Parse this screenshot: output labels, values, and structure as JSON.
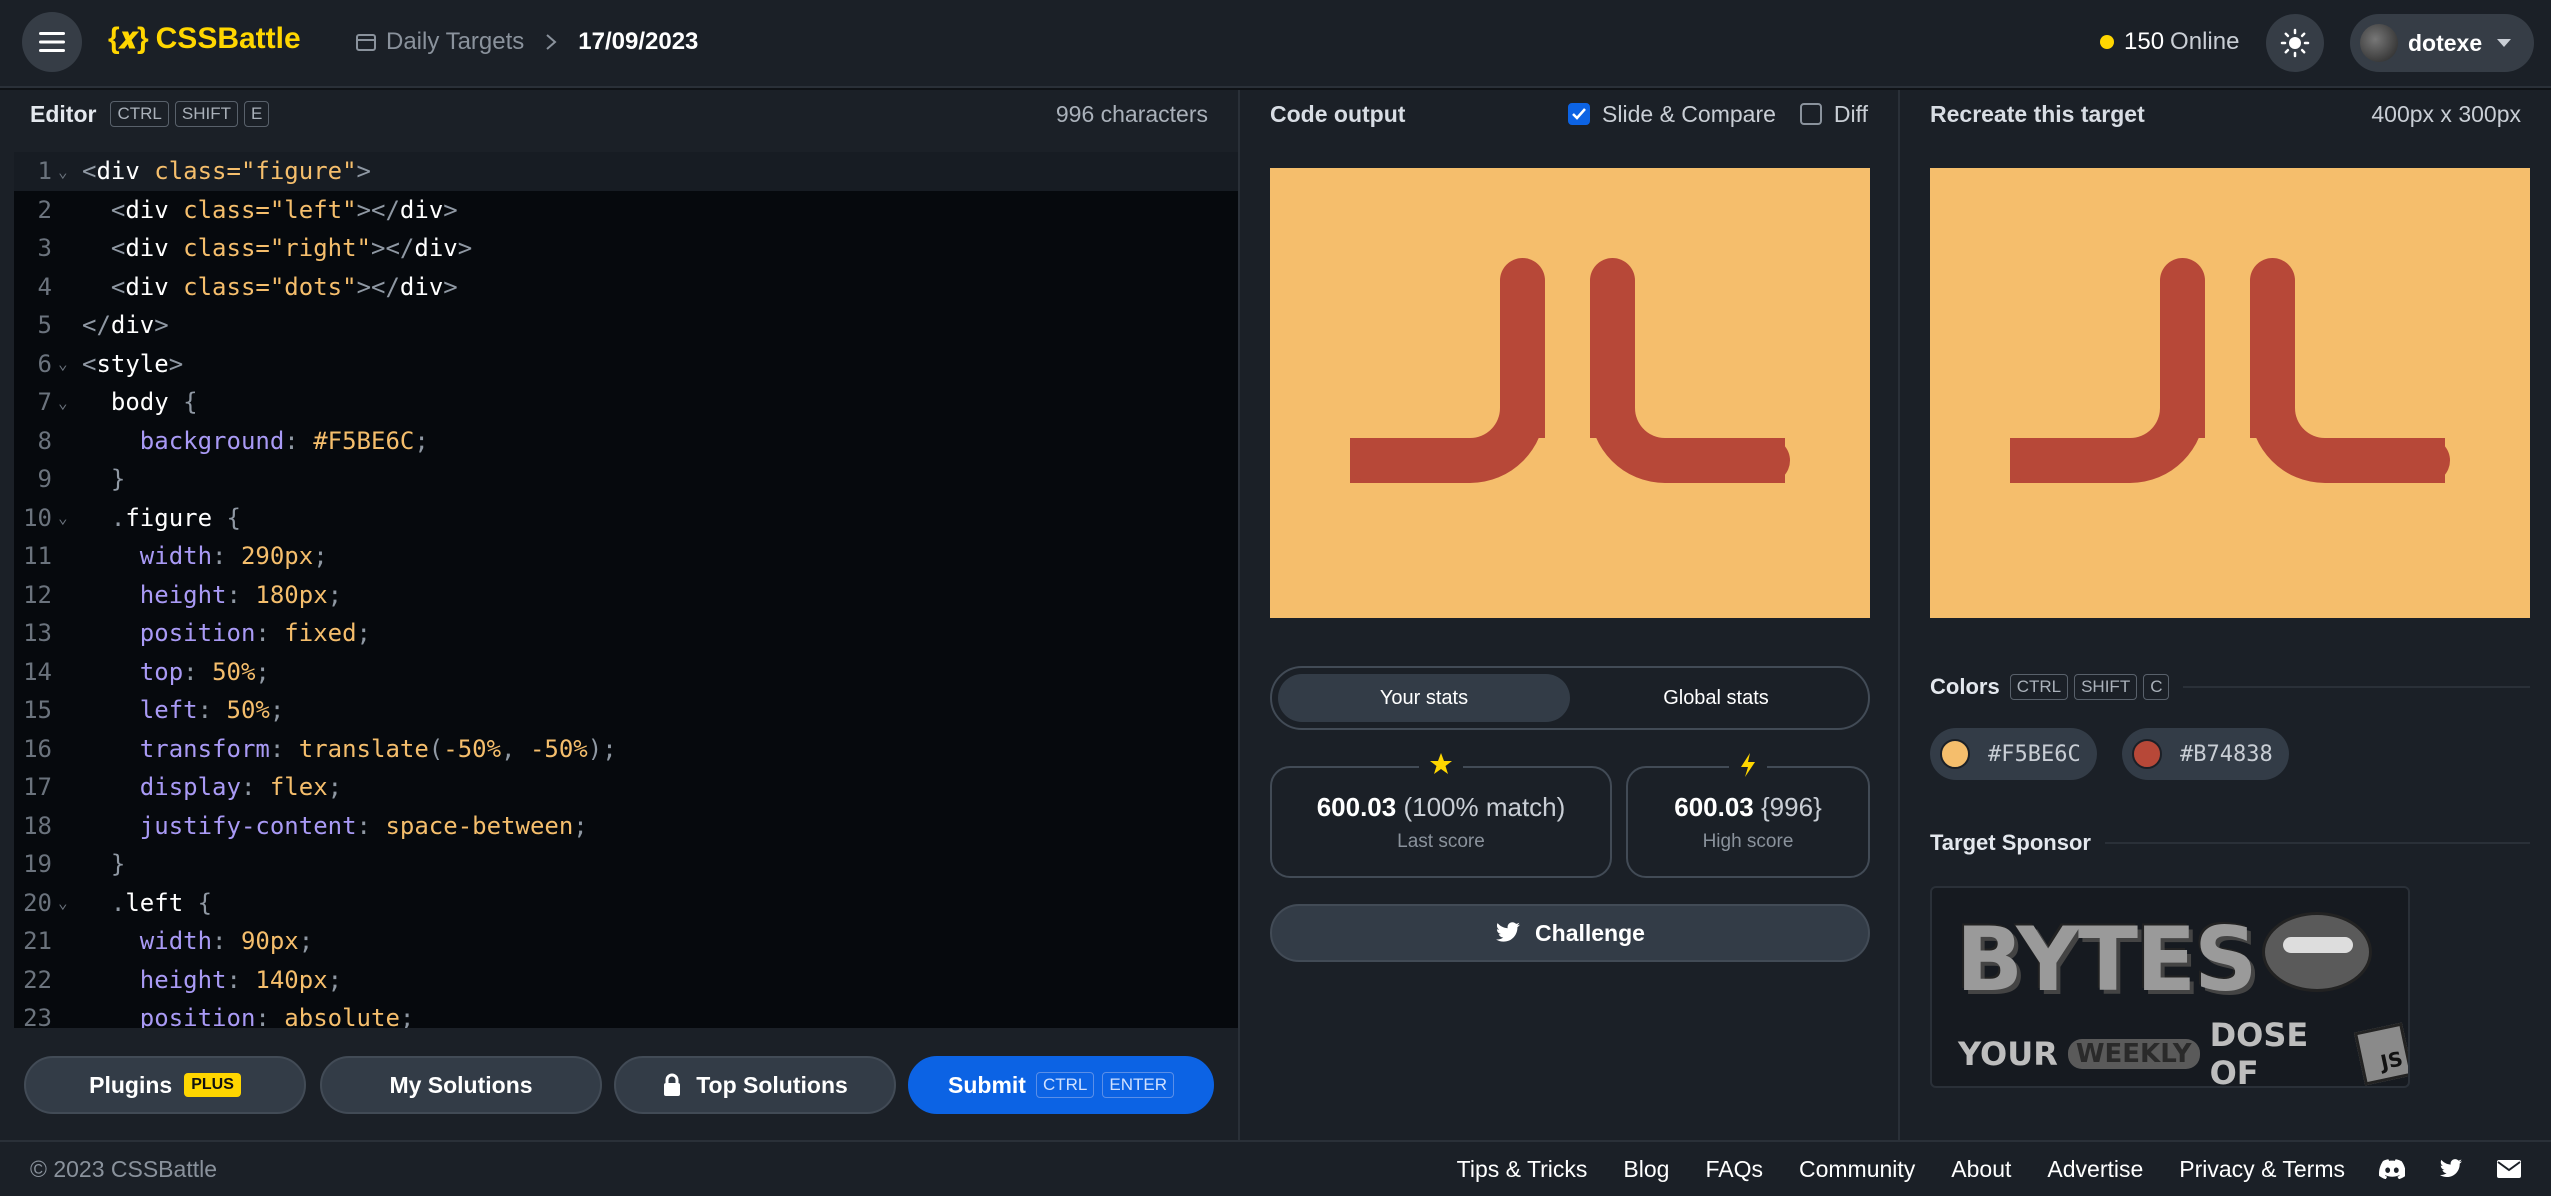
{
  "header": {
    "brand": "CSSBattle",
    "brand_logo": "{𝒙}",
    "breadcrumb_section": "Daily Targets",
    "breadcrumb_date": "17/09/2023",
    "online_count": "150",
    "online_label": "Online",
    "username": "dotexe",
    "icons": [
      "hamburger-icon",
      "calendar-icon",
      "chevron-right-icon",
      "sun-icon",
      "chevron-down-icon"
    ]
  },
  "editor": {
    "title": "Editor",
    "shortcut": [
      "CTRL",
      "SHIFT",
      "E"
    ],
    "char_count": "996 characters",
    "lines": [
      {
        "n": "1",
        "fold": true,
        "active": true,
        "tokens": [
          [
            "punc",
            "<"
          ],
          [
            "tag",
            "div "
          ],
          [
            "attr",
            "class="
          ],
          [
            "str",
            "\"figure\""
          ],
          [
            "punc",
            ">"
          ]
        ]
      },
      {
        "n": "2",
        "tokens": [
          [
            "punc",
            "  <"
          ],
          [
            "tag",
            "div "
          ],
          [
            "attr",
            "class="
          ],
          [
            "str",
            "\"left\""
          ],
          [
            "punc",
            "></"
          ],
          [
            "tag",
            "div"
          ],
          [
            "punc",
            ">"
          ]
        ]
      },
      {
        "n": "3",
        "tokens": [
          [
            "punc",
            "  <"
          ],
          [
            "tag",
            "div "
          ],
          [
            "attr",
            "class="
          ],
          [
            "str",
            "\"right\""
          ],
          [
            "punc",
            "></"
          ],
          [
            "tag",
            "div"
          ],
          [
            "punc",
            ">"
          ]
        ]
      },
      {
        "n": "4",
        "tokens": [
          [
            "punc",
            "  <"
          ],
          [
            "tag",
            "div "
          ],
          [
            "attr",
            "class="
          ],
          [
            "str",
            "\"dots\""
          ],
          [
            "punc",
            "></"
          ],
          [
            "tag",
            "div"
          ],
          [
            "punc",
            ">"
          ]
        ]
      },
      {
        "n": "5",
        "tokens": [
          [
            "punc",
            "</"
          ],
          [
            "tag",
            "div"
          ],
          [
            "punc",
            ">"
          ]
        ]
      },
      {
        "n": "6",
        "fold": true,
        "tokens": [
          [
            "punc",
            "<"
          ],
          [
            "tag",
            "style"
          ],
          [
            "punc",
            ">"
          ]
        ]
      },
      {
        "n": "7",
        "fold": true,
        "tokens": [
          [
            "sel",
            "  body "
          ],
          [
            "punc",
            "{"
          ]
        ]
      },
      {
        "n": "8",
        "tokens": [
          [
            "prop",
            "    background"
          ],
          [
            "punc",
            ": "
          ],
          [
            "val",
            "#F5BE6C"
          ],
          [
            "punc",
            ";"
          ]
        ]
      },
      {
        "n": "9",
        "tokens": [
          [
            "punc",
            "  }"
          ]
        ]
      },
      {
        "n": "10",
        "fold": true,
        "tokens": [
          [
            "punc",
            "  ."
          ],
          [
            "sel",
            "figure "
          ],
          [
            "punc",
            "{"
          ]
        ]
      },
      {
        "n": "11",
        "tokens": [
          [
            "prop",
            "    width"
          ],
          [
            "punc",
            ": "
          ],
          [
            "val",
            "290px"
          ],
          [
            "punc",
            ";"
          ]
        ]
      },
      {
        "n": "12",
        "tokens": [
          [
            "prop",
            "    height"
          ],
          [
            "punc",
            ": "
          ],
          [
            "val",
            "180px"
          ],
          [
            "punc",
            ";"
          ]
        ]
      },
      {
        "n": "13",
        "tokens": [
          [
            "prop",
            "    position"
          ],
          [
            "punc",
            ": "
          ],
          [
            "val",
            "fixed"
          ],
          [
            "punc",
            ";"
          ]
        ]
      },
      {
        "n": "14",
        "tokens": [
          [
            "prop",
            "    top"
          ],
          [
            "punc",
            ": "
          ],
          [
            "val",
            "50%"
          ],
          [
            "punc",
            ";"
          ]
        ]
      },
      {
        "n": "15",
        "tokens": [
          [
            "prop",
            "    left"
          ],
          [
            "punc",
            ": "
          ],
          [
            "val",
            "50%"
          ],
          [
            "punc",
            ";"
          ]
        ]
      },
      {
        "n": "16",
        "tokens": [
          [
            "prop",
            "    transform"
          ],
          [
            "punc",
            ": "
          ],
          [
            "val",
            "translate"
          ],
          [
            "punc",
            "("
          ],
          [
            "val",
            "-50%"
          ],
          [
            "punc",
            ", "
          ],
          [
            "val",
            "-50%"
          ],
          [
            "punc",
            ");"
          ]
        ]
      },
      {
        "n": "17",
        "tokens": [
          [
            "prop",
            "    display"
          ],
          [
            "punc",
            ": "
          ],
          [
            "val",
            "flex"
          ],
          [
            "punc",
            ";"
          ]
        ]
      },
      {
        "n": "18",
        "tokens": [
          [
            "prop",
            "    justify-content"
          ],
          [
            "punc",
            ": "
          ],
          [
            "val",
            "space-between"
          ],
          [
            "punc",
            ";"
          ]
        ]
      },
      {
        "n": "19",
        "tokens": [
          [
            "punc",
            "  }"
          ]
        ]
      },
      {
        "n": "20",
        "fold": true,
        "tokens": [
          [
            "punc",
            "  ."
          ],
          [
            "sel",
            "left "
          ],
          [
            "punc",
            "{"
          ]
        ]
      },
      {
        "n": "21",
        "tokens": [
          [
            "prop",
            "    width"
          ],
          [
            "punc",
            ": "
          ],
          [
            "val",
            "90px"
          ],
          [
            "punc",
            ";"
          ]
        ]
      },
      {
        "n": "22",
        "tokens": [
          [
            "prop",
            "    height"
          ],
          [
            "punc",
            ": "
          ],
          [
            "val",
            "140px"
          ],
          [
            "punc",
            ";"
          ]
        ]
      },
      {
        "n": "23",
        "tokens": [
          [
            "prop",
            "    position"
          ],
          [
            "punc",
            ": "
          ],
          [
            "val",
            "absolute"
          ],
          [
            "punc",
            ";"
          ]
        ]
      }
    ]
  },
  "editor_footer": {
    "plugins_label": "Plugins",
    "plugins_badge": "PLUS",
    "my_solutions_label": "My Solutions",
    "top_solutions_label": "Top Solutions",
    "submit_label": "Submit",
    "submit_shortcut": [
      "CTRL",
      "ENTER"
    ]
  },
  "output": {
    "title": "Code output",
    "slide_compare_label": "Slide & Compare",
    "slide_compare_checked": true,
    "diff_label": "Diff",
    "diff_checked": false,
    "tabs": [
      "Your stats",
      "Global stats"
    ],
    "active_tab": "Your stats",
    "last_score": "600.03",
    "last_score_detail": "(100% match)",
    "last_score_label": "Last score",
    "high_score": "600.03",
    "high_score_detail": "{996}",
    "high_score_label": "High score",
    "challenge_label": "Challenge"
  },
  "target": {
    "title": "Recreate this target",
    "size": "400px x 300px",
    "colors_title": "Colors",
    "colors_shortcut": [
      "CTRL",
      "SHIFT",
      "C"
    ],
    "colors": [
      {
        "hex": "#F5BE6C",
        "label": "#F5BE6C"
      },
      {
        "hex": "#B74838",
        "label": "#B74838"
      }
    ],
    "sponsor_title": "Target Sponsor",
    "sponsor_text": "BYTES",
    "sponsor_tagline_1": "YOUR",
    "sponsor_tagline_2": "WEEKLY",
    "sponsor_tagline_3": "DOSE OF",
    "sponsor_tagline_4": "JS"
  },
  "palette": {
    "bg": "#F5BE6C",
    "fg": "#B74838",
    "accent": "#FFD600",
    "primary": "#0C63E4"
  },
  "footer": {
    "copyright": "© 2023 CSSBattle",
    "links": [
      "Tips & Tricks",
      "Blog",
      "FAQs",
      "Community",
      "About",
      "Advertise",
      "Privacy & Terms"
    ],
    "icons": [
      "discord-icon",
      "twitter-icon",
      "mail-icon"
    ]
  }
}
